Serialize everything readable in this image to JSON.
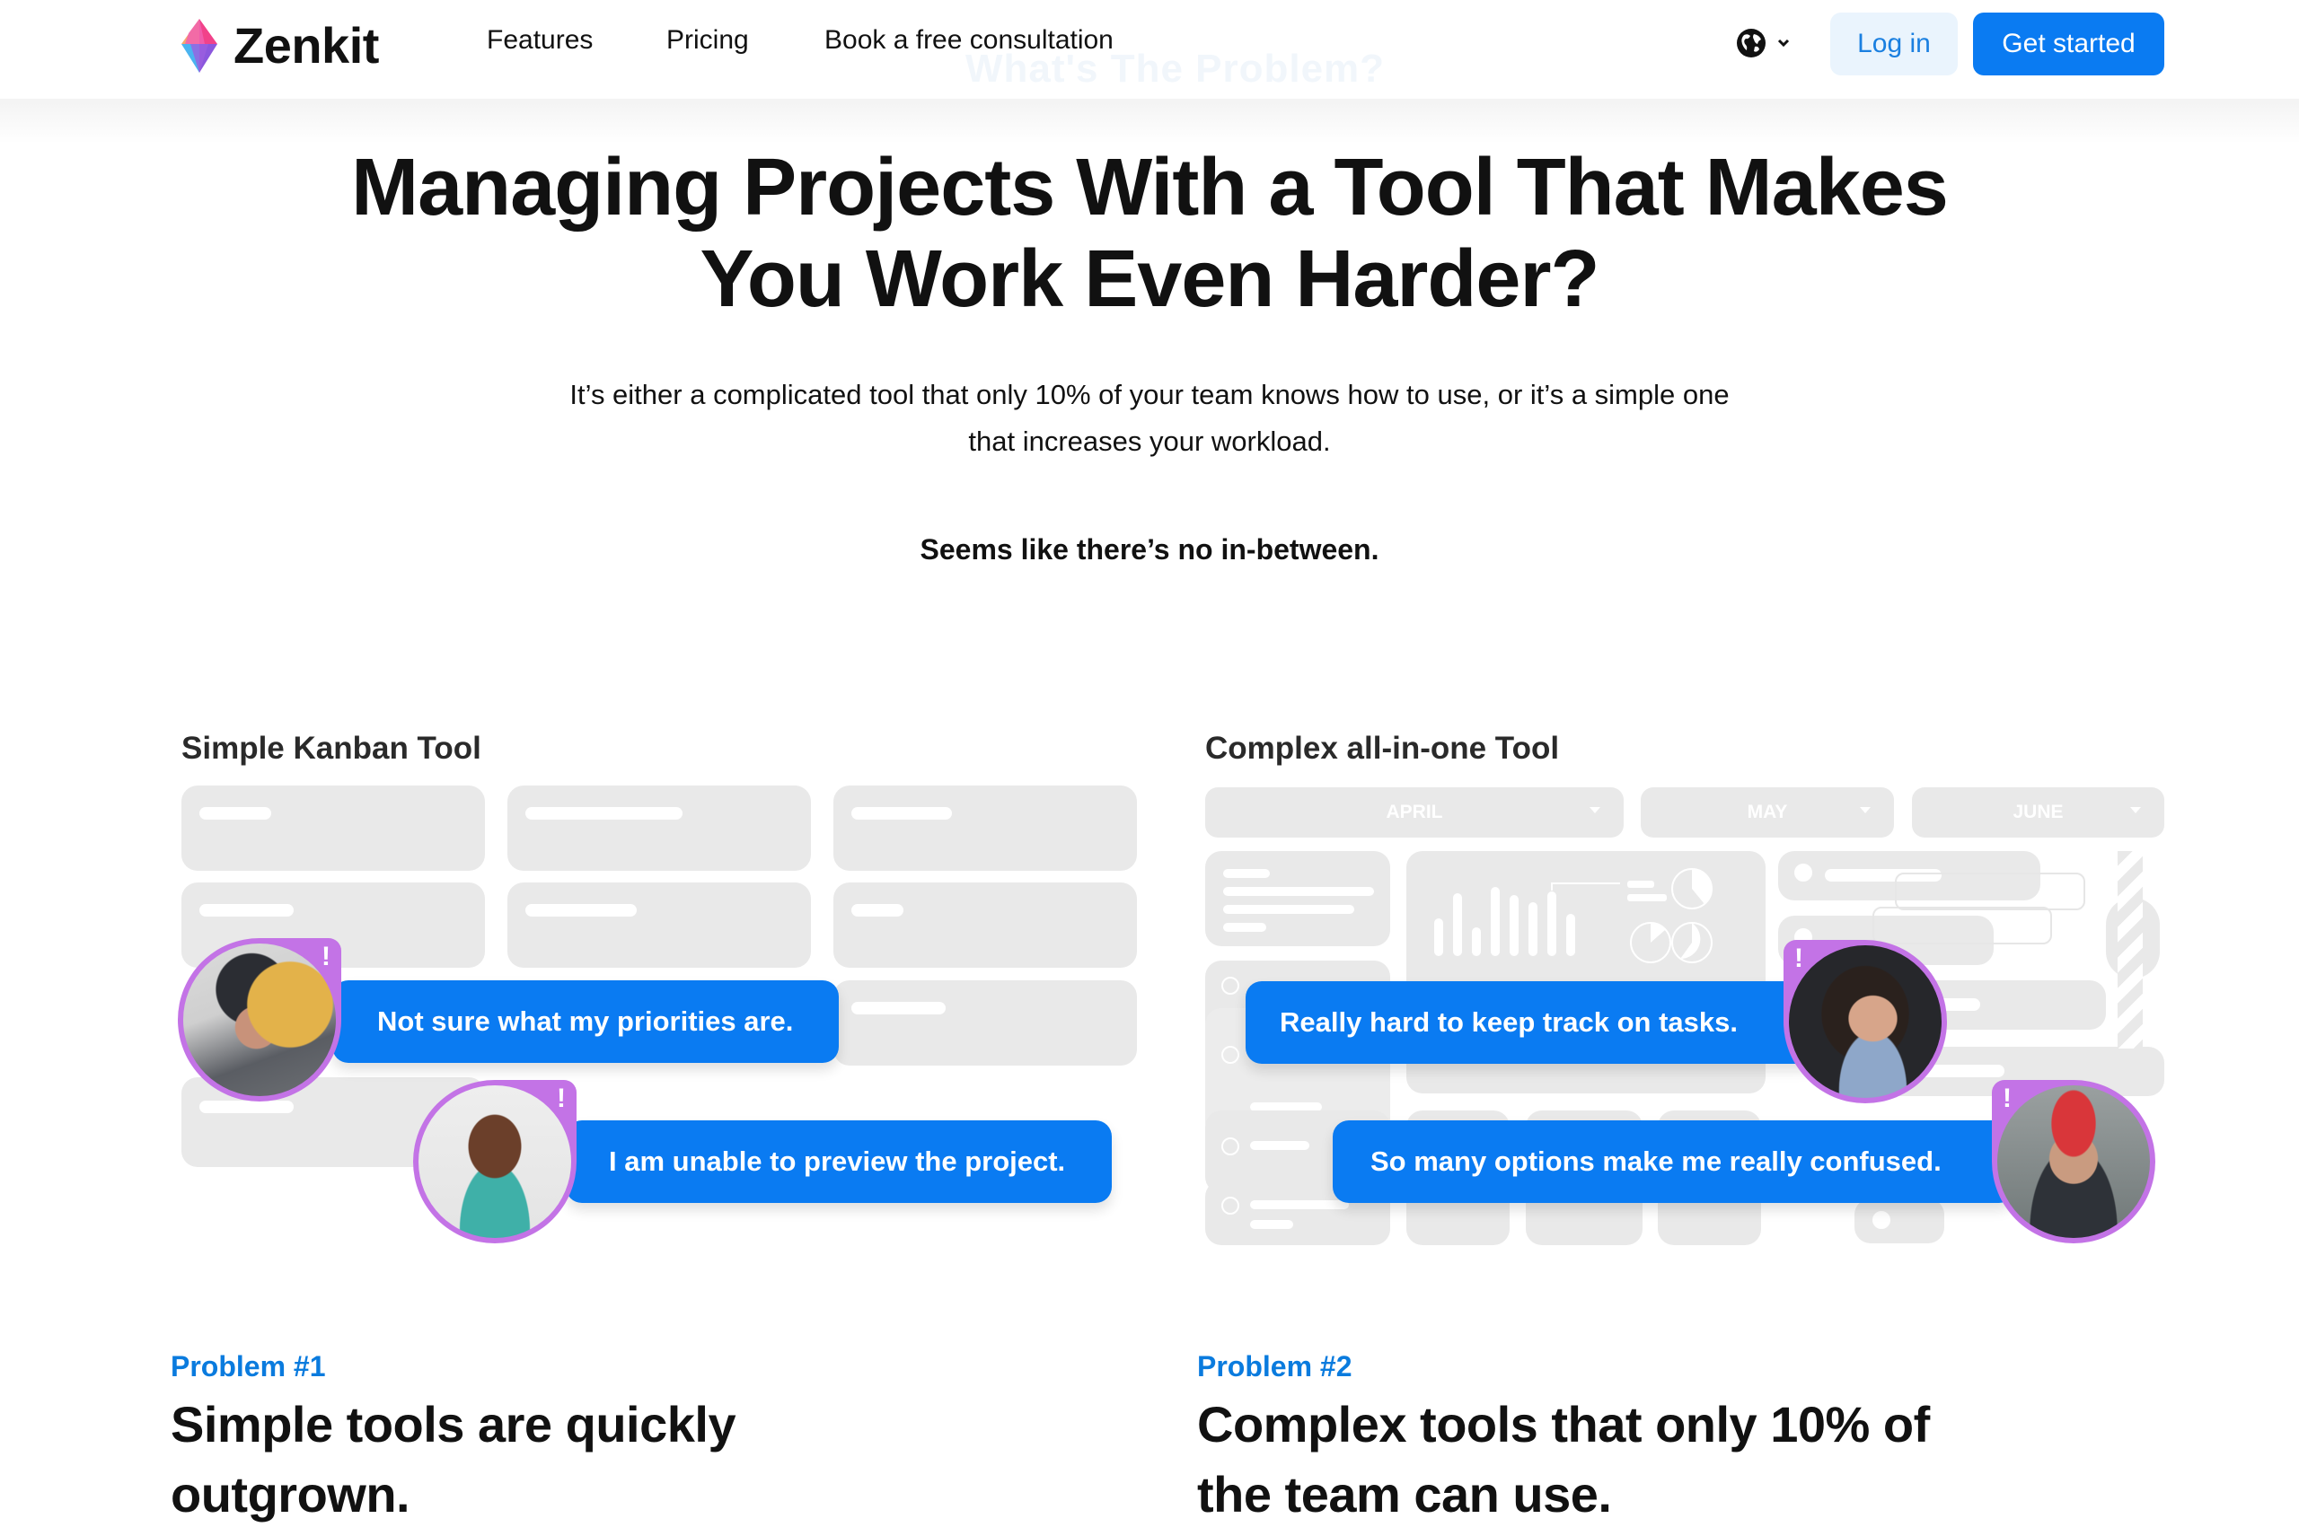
{
  "header": {
    "brand": "Zenkit",
    "nav": [
      "Features",
      "Pricing",
      "Book a free consultation"
    ],
    "language_icon": "globe-icon",
    "login_label": "Log in",
    "get_started_label": "Get started",
    "watermark": "What's The Problem?"
  },
  "hero": {
    "title_line1": "Managing Projects With a Tool That Makes",
    "title_line2": "You Work Even Harder?",
    "subtitle_line1": "It’s either a complicated tool that only 10% of your team knows how to use, or it’s a simple one",
    "subtitle_line2": "that increases your workload.",
    "tagline": "Seems like there’s no in-between."
  },
  "illustrations": {
    "simple": {
      "label": "Simple Kanban Tool",
      "bubbles": [
        "Not sure what my priorities are.",
        "I am unable to preview the project."
      ]
    },
    "complex": {
      "label": "Complex all-in-one Tool",
      "months": [
        "APRIL",
        "MAY",
        "JUNE"
      ],
      "bubbles": [
        "Really hard to keep track on tasks.",
        "So many options make me really confused."
      ]
    },
    "alert_mark": "!"
  },
  "problems": [
    {
      "label": "Problem #1",
      "heading_line1": "Simple tools are quickly",
      "heading_line2": "outgrown."
    },
    {
      "label": "Problem #2",
      "heading_line1": "Complex tools that only 10% of",
      "heading_line2": "the team can use."
    }
  ],
  "colors": {
    "accent_blue": "#0a7bf2",
    "label_blue": "#0a7bde",
    "avatar_ring": "#c373e6",
    "placeholder_gray": "#e9e9e9"
  }
}
